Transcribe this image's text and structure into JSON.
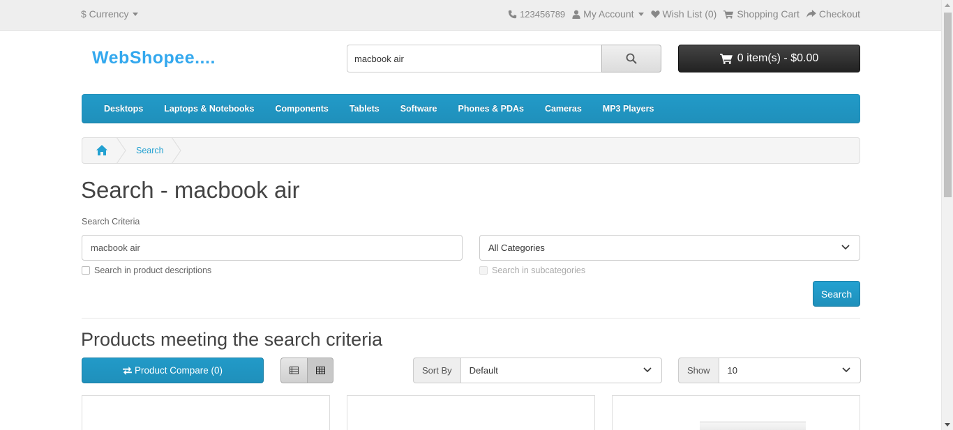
{
  "topbar": {
    "currency": "$ Currency",
    "phone": "123456789",
    "my_account": "My Account",
    "wish_list": "Wish List (0)",
    "shopping_cart": "Shopping Cart",
    "checkout": "Checkout"
  },
  "header": {
    "logo": "WebShopee....",
    "search_value": "macbook air",
    "cart": "0 item(s) - $0.00"
  },
  "menu": [
    "Desktops",
    "Laptops & Notebooks",
    "Components",
    "Tablets",
    "Software",
    "Phones & PDAs",
    "Cameras",
    "MP3 Players"
  ],
  "breadcrumb": {
    "current": "Search"
  },
  "page": {
    "title": "Search - macbook air",
    "criteria_label": "Search Criteria",
    "search_field_value": "macbook air",
    "category": "All Categories",
    "cb_description": "Search in product descriptions",
    "cb_subcategories": "Search in subcategories",
    "search_button": "Search",
    "results_title": "Products meeting the search criteria",
    "compare": "Product Compare (0)",
    "sort_label": "Sort By",
    "sort_value": "Default",
    "show_label": "Show",
    "show_value": "10"
  },
  "colors": {
    "accent": "#229ac8",
    "logo": "#33a8ee",
    "cart_button": "#333333"
  }
}
